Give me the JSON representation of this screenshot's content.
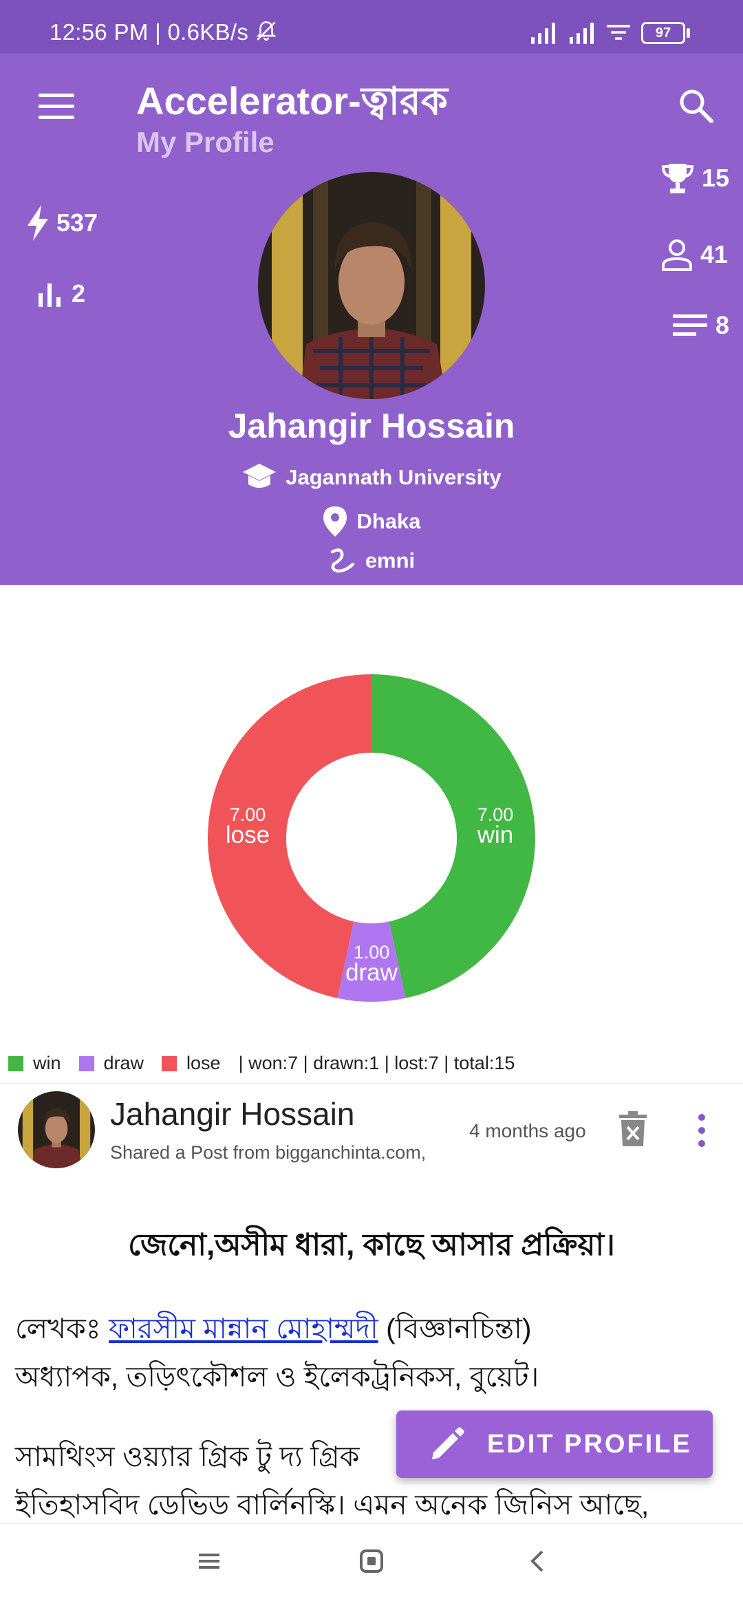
{
  "status_bar": {
    "time_speed": "12:56 PM | 0.6KB/s",
    "battery": "97"
  },
  "header": {
    "app_title": "Accelerator-ত্বারক",
    "subtitle": "My Profile",
    "stats": {
      "energy": "537",
      "rank": "2",
      "trophies": "15",
      "followers": "41",
      "posts": "8"
    },
    "name": "Jahangir Hossain",
    "university": "Jagannath University",
    "location": "Dhaka",
    "tag": "emni"
  },
  "chart_data": {
    "type": "pie",
    "categories": [
      "win",
      "draw",
      "lose"
    ],
    "values": [
      7,
      1,
      7
    ],
    "value_labels": [
      "7.00",
      "1.00",
      "7.00"
    ],
    "colors": [
      "#41b744",
      "#b075f0",
      "#f05458"
    ],
    "summary": "| won:7 | drawn:1 | lost:7 | total:15",
    "legend_position": "bottom-left"
  },
  "post": {
    "author": "Jahangir Hossain",
    "subtitle": "Shared a Post from bigganchinta.com,",
    "time": "4 months ago",
    "title": "জেনো,অসীম ধারা, কাছে আসার প্রক্রিয়া।",
    "author_prefix": "লেখকঃ",
    "author_link": "ফারসীম মান্নান মোহাম্মদী",
    "author_suffix": "(বিজ্ঞানচিন্তা)",
    "line2": "অধ্যাপক, তড়িৎকৌশল ও ইলেকট্রনিকস, বুয়েট।",
    "line3": "সামথিংস ওয়্যার গ্রিক টু দ্য গ্রিক",
    "line4": "ইতিহাসবিদ ডেভিড বার্লিনস্কি। এমন অনেক জিনিস আছে,"
  },
  "fab": {
    "label": "EDIT PROFILE"
  }
}
